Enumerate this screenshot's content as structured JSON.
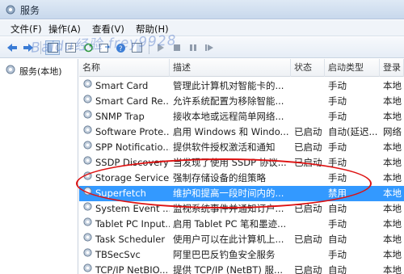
{
  "window": {
    "title": "服务"
  },
  "menu": {
    "items": [
      "文件(F)",
      "操作(A)",
      "查看(V)",
      "帮助(H)"
    ]
  },
  "watermark": "Baidu经验 frey9928",
  "tree": {
    "root_label": "服务(本地)"
  },
  "columns": [
    "名称",
    "描述",
    "状态",
    "启动类型",
    "登录"
  ],
  "rows": [
    {
      "name": "Smart Card",
      "desc": "管理此计算机对智能卡的...",
      "status": "",
      "startup": "手动",
      "logon": "本地"
    },
    {
      "name": "Smart Card Re...",
      "desc": "允许系统配置为移除智能...",
      "status": "",
      "startup": "手动",
      "logon": "本地"
    },
    {
      "name": "SNMP Trap",
      "desc": "接收本地或远程简单网络...",
      "status": "",
      "startup": "手动",
      "logon": "本地"
    },
    {
      "name": "Software Prote...",
      "desc": "启用 Windows 和 Windo...",
      "status": "已启动",
      "startup": "自动(延迟...",
      "logon": "网络"
    },
    {
      "name": "SPP Notificatio...",
      "desc": "提供软件授权激活和通知",
      "status": "已启动",
      "startup": "手动",
      "logon": "本地"
    },
    {
      "name": "SSDP Discovery",
      "desc": "当发现了使用 SSDP 协议...",
      "status": "已启动",
      "startup": "手动",
      "logon": "本地"
    },
    {
      "name": "Storage Service",
      "desc": "强制存储设备的组策略",
      "status": "",
      "startup": "手动",
      "logon": "本地"
    },
    {
      "name": "Superfetch",
      "desc": "维护和提高一段时间内的...",
      "status": "",
      "startup": "禁用",
      "logon": "本地",
      "selected": true
    },
    {
      "name": "System Event ...",
      "desc": "监视系统事件并通知订户...",
      "status": "已启动",
      "startup": "自动",
      "logon": "本地"
    },
    {
      "name": "Tablet PC Input...",
      "desc": "启用 Tablet PC 笔和墨迹...",
      "status": "",
      "startup": "手动",
      "logon": "本地"
    },
    {
      "name": "Task Scheduler",
      "desc": "使用户可以在此计算机上...",
      "status": "已启动",
      "startup": "自动",
      "logon": "本地"
    },
    {
      "name": "TBSecSvc",
      "desc": "阿里巴巴反钓鱼安全服务",
      "status": "",
      "startup": "手动",
      "logon": "本地"
    },
    {
      "name": "TCP/IP NetBIO...",
      "desc": "提供 TCP/IP (NetBT) 服...",
      "status": "已启动",
      "startup": "自动",
      "logon": "本地"
    }
  ],
  "colors": {
    "selection": "#3399ff",
    "annotation": "#dd1111"
  }
}
